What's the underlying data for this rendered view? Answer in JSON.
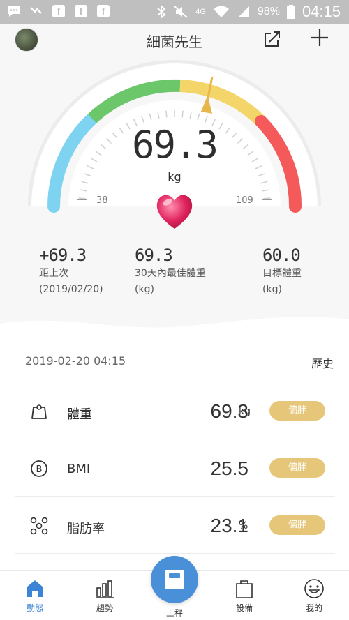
{
  "status_bar": {
    "battery": "98%",
    "time": "04:15",
    "network": "4G"
  },
  "header": {
    "title": "細菌先生",
    "share_icon": "share-icon",
    "add_icon": "plus-icon"
  },
  "gauge": {
    "weight": "69.3",
    "unit": "kg",
    "min": "38",
    "max": "109",
    "level": 0.44,
    "colors": [
      "#7dd3f0",
      "#6cc66a",
      "#f4d56a",
      "#f45a5a"
    ]
  },
  "stats": [
    {
      "value": "+69.3",
      "label1": "距上次",
      "label2": "(2019/02/20)"
    },
    {
      "value": "69.3",
      "label1": "30天內最佳體重",
      "label2": "(kg)"
    },
    {
      "value": "60.0",
      "label1": "目標體重",
      "label2": "(kg)"
    }
  ],
  "list": {
    "date": "2019-02-20 04:15",
    "history_label": "歷史",
    "rows": [
      {
        "name": "體重",
        "value": "69.3",
        "unit": "kg",
        "badge": "偏胖",
        "icon": "weight-icon"
      },
      {
        "name": "BMI",
        "value": "25.5",
        "unit": "",
        "badge": "偏胖",
        "icon": "bmi-icon"
      },
      {
        "name": "脂肪率",
        "value": "23.1",
        "unit": "%",
        "badge": "偏胖",
        "icon": "fat-icon"
      }
    ]
  },
  "nav": {
    "items": [
      {
        "label": "動態",
        "icon": "home-icon"
      },
      {
        "label": "趨勢",
        "icon": "trend-icon"
      },
      {
        "label": "上秤",
        "icon": "scale-icon"
      },
      {
        "label": "設備",
        "icon": "device-icon"
      },
      {
        "label": "我的",
        "icon": "smiley-icon"
      }
    ]
  }
}
